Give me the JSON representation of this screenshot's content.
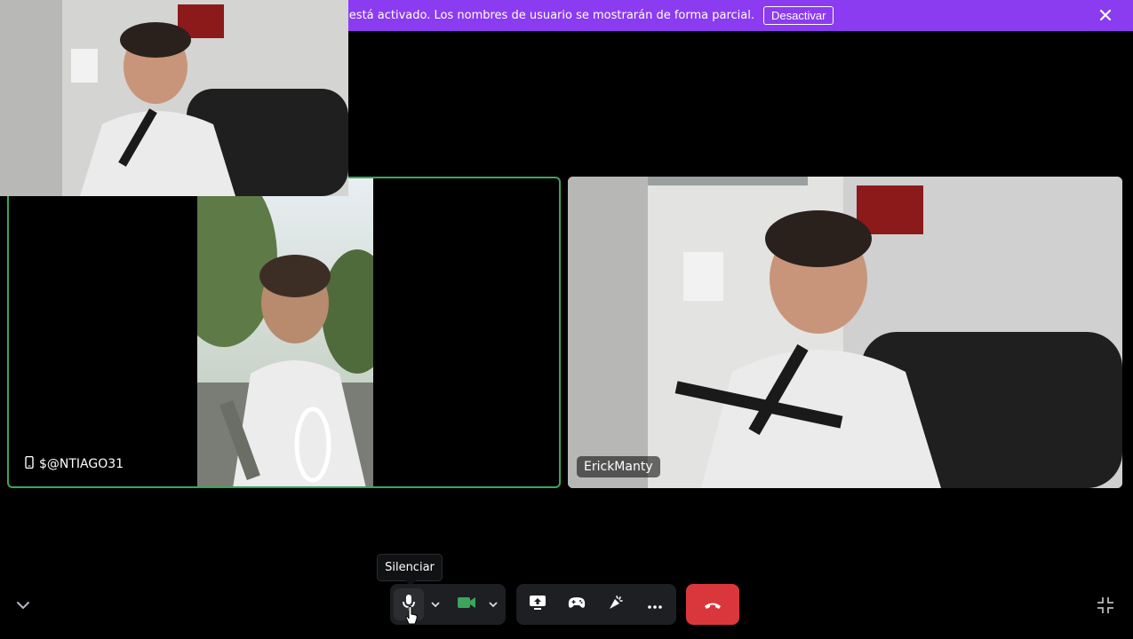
{
  "banner": {
    "message": "treamer está activado. Los nombres de usuario se mostrarán de forma parcial.",
    "button_label": "Desactivar",
    "color": "#8b3bf0"
  },
  "participants": [
    {
      "name": "$@NTIAGO31",
      "device_icon": "mobile-phone-icon",
      "speaking_border": "#3ba55c"
    },
    {
      "name": "ErickManty"
    }
  ],
  "tooltip": {
    "text": "Silenciar"
  },
  "controls": {
    "mic_icon": "microphone-icon",
    "camera_icon": "video-camera-icon",
    "screen_share_icon": "screen-share-icon",
    "activities_icon": "game-controller-icon",
    "soundboard_icon": "soundboard-icon",
    "more_icon": "more-dots-icon",
    "hangup_icon": "phone-hangup-icon",
    "hangup_color": "#da373c",
    "camera_color": "#3ba55c"
  }
}
